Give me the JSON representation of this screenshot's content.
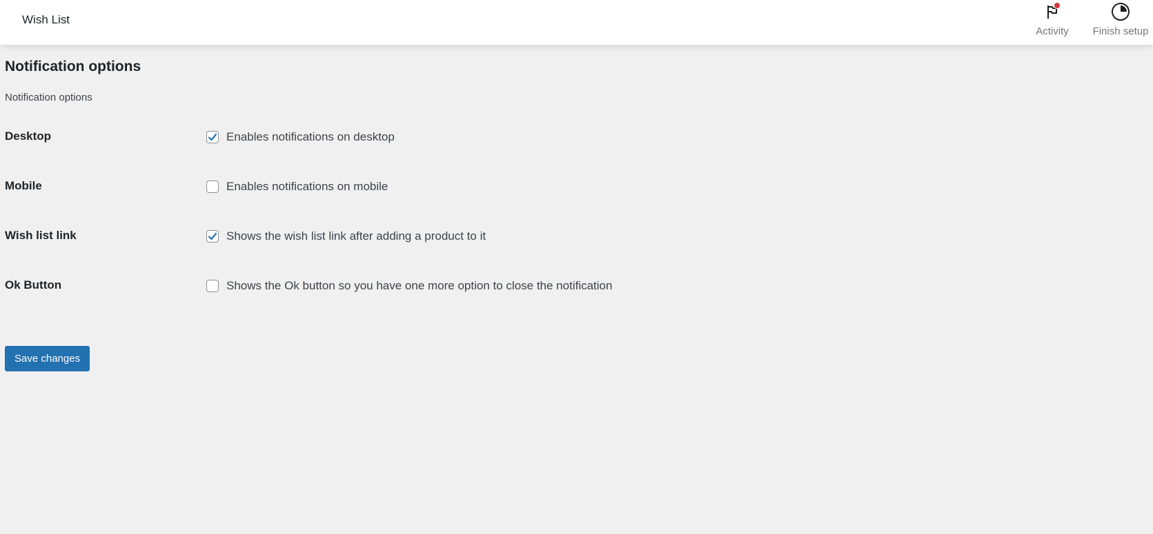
{
  "header": {
    "title": "Wish List",
    "actions": [
      {
        "label": "Activity",
        "icon": "flag-icon",
        "has_notification": true
      },
      {
        "label": "Finish setup",
        "icon": "progress-circle-icon"
      }
    ]
  },
  "page": {
    "title": "Notification options",
    "description": "Notification options"
  },
  "options": [
    {
      "label": "Desktop",
      "text": "Enables notifications on desktop",
      "checked": true
    },
    {
      "label": "Mobile",
      "text": "Enables notifications on mobile",
      "checked": false
    },
    {
      "label": "Wish list link",
      "text": "Shows the wish list link after adding a product to it",
      "checked": true
    },
    {
      "label": "Ok Button",
      "text": "Shows the Ok button so you have one more option to close the notification",
      "checked": false
    }
  ],
  "save_button": {
    "label": "Save changes"
  },
  "colors": {
    "accent": "#2271b1",
    "background": "#f0f0f1",
    "notification_dot": "#d63638"
  }
}
